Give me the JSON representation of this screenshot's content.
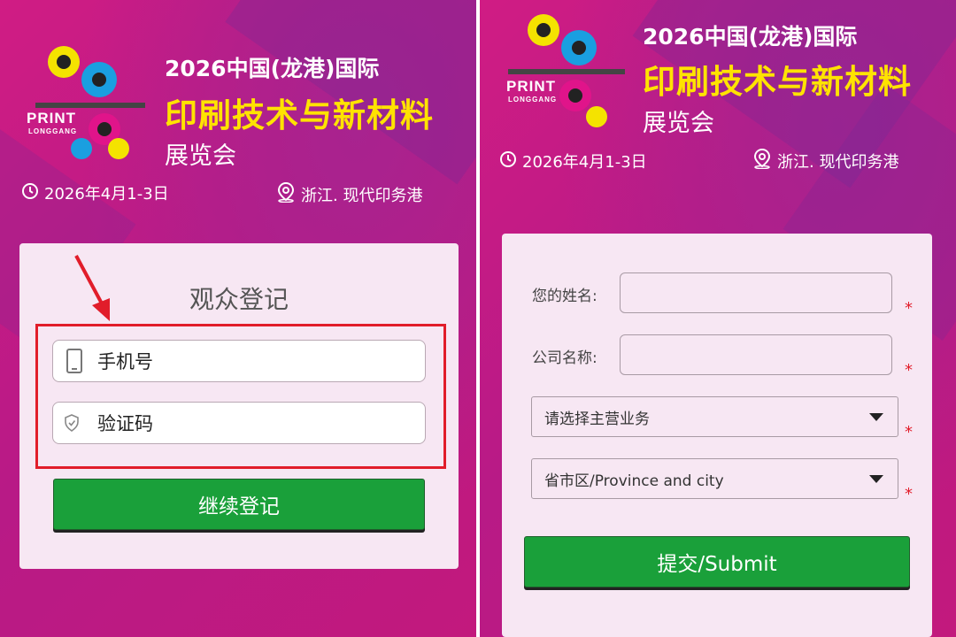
{
  "colors": {
    "background": "#c2187f",
    "title_yellow": "#ffe300",
    "card": "#f7e7f3",
    "button_green": "#1aa03a",
    "highlight_red": "#e11d2a"
  },
  "logo": {
    "brand": "PRINT",
    "subbrand": "LONGGANG"
  },
  "event": {
    "line1": "2026中国(龙港)国际",
    "line2": "印刷技术与新材料",
    "line3": "展览会",
    "date": "2026年4月1-3日",
    "location": "浙江. 现代印务港"
  },
  "login_form": {
    "title": "观众登记",
    "phone_placeholder": "手机号",
    "code_placeholder": "验证码",
    "continue_button": "继续登记",
    "phone_icon": "mobile-phone-icon",
    "code_icon": "shield-check-icon",
    "annotation_icon": "red-arrow-icon"
  },
  "registration_form": {
    "name_label": "您的姓名:",
    "company_label": "公司名称:",
    "business_select": "请选择主营业务",
    "region_select": "省市区/Province and city",
    "required_mark": "*",
    "submit_button": "提交/Submit"
  }
}
